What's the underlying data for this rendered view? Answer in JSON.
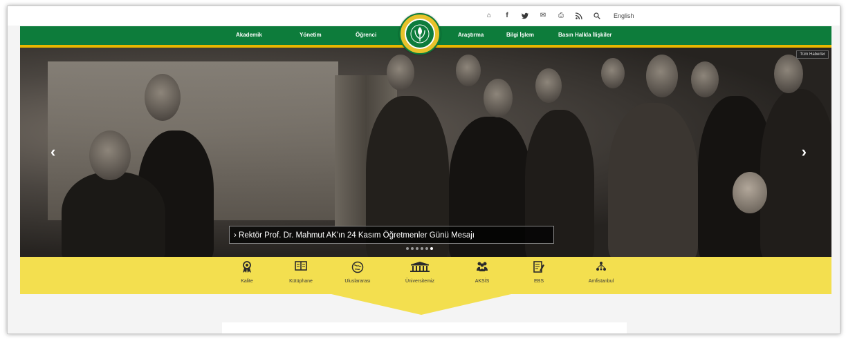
{
  "utility": {
    "icons": [
      "home-icon",
      "facebook-icon",
      "twitter-icon",
      "mail-icon",
      "print-icon",
      "rss-icon",
      "search-icon"
    ],
    "language": "English"
  },
  "nav": {
    "left": [
      "Akademik",
      "Yönetim",
      "Öğrenci"
    ],
    "right": [
      "Araştırma",
      "Bilgi İşlem",
      "Basın Halkla İlişkiler"
    ]
  },
  "hero": {
    "all_news": "Tüm Haberler",
    "caption": "Rektör Prof. Dr. Mahmut AK'ın 24 Kasım Öğretmenler Günü Mesajı",
    "slide_count": 6,
    "active_slide": 6
  },
  "quick_links": [
    {
      "label": "Kalite",
      "icon": "award-icon"
    },
    {
      "label": "Kütüphane",
      "icon": "book-icon"
    },
    {
      "label": "Uluslararası",
      "icon": "globe-icon"
    },
    {
      "label": "Üniversitemiz",
      "icon": "university-building-icon"
    },
    {
      "label": "AKSİS",
      "icon": "users-icon"
    },
    {
      "label": "EBS",
      "icon": "document-edit-icon"
    },
    {
      "label": "Amfistanbul",
      "icon": "network-icon"
    }
  ],
  "colors": {
    "nav_green": "#0d7c3b",
    "accent_gold": "#e8b600",
    "quick_yellow": "#f3df4f"
  }
}
